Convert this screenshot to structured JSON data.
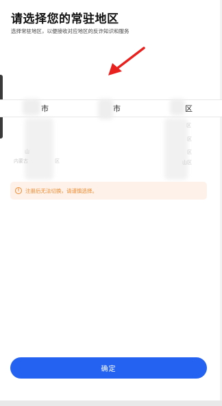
{
  "header": {
    "title": "请选择您的常驻地区",
    "subtitle": "选择常驻地区，以便接收对应地区的反诈知识和服务"
  },
  "picker": {
    "selected": {
      "col1": "市",
      "col2": "市",
      "col3": "区"
    },
    "faded_rows": {
      "col1_row1": "山",
      "col1_row2": "内蒙古",
      "col1_row2_right": "区",
      "col3_row1": "区",
      "col3_row2": "区",
      "col3_row3": "区",
      "col3_row4": "山区"
    }
  },
  "notice": {
    "icon": "info-icon",
    "text": "注册后无法切换，请谨慎选择。",
    "color": "#f08a2c"
  },
  "footer": {
    "confirm_label": "确定",
    "button_color": "#2463f2"
  },
  "annotation": {
    "arrow_color": "#e8201e"
  }
}
